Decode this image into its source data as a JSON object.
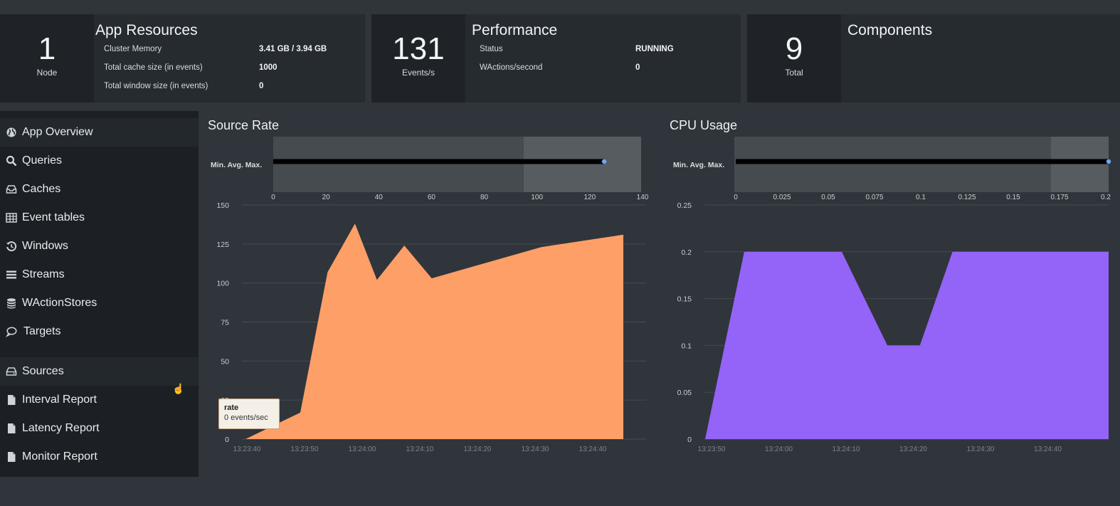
{
  "cards": {
    "resources": {
      "stat_value": "1",
      "stat_unit": "Node",
      "title": "App Resources",
      "rows": [
        {
          "label": "Cluster Memory",
          "value": "3.41 GB / 3.94 GB"
        },
        {
          "label": "Total cache size (in events)",
          "value": "1000"
        },
        {
          "label": "Total window size (in events)",
          "value": "0"
        }
      ]
    },
    "performance": {
      "stat_value": "131",
      "stat_unit": "Events/s",
      "title": "Performance",
      "rows": [
        {
          "label": "Status",
          "value": "RUNNING"
        },
        {
          "label": "WActions/second",
          "value": "0"
        }
      ]
    },
    "components": {
      "stat_value": "9",
      "stat_unit": "Total",
      "title": "Components"
    }
  },
  "sidebar": {
    "items": [
      {
        "label": "App Overview",
        "icon": "globe-icon",
        "active": true
      },
      {
        "label": "Queries",
        "icon": "search-icon"
      },
      {
        "label": "Caches",
        "icon": "inbox-icon"
      },
      {
        "label": "Event tables",
        "icon": "table-icon"
      },
      {
        "label": "Windows",
        "icon": "history-icon"
      },
      {
        "label": "Streams",
        "icon": "bars-icon"
      },
      {
        "label": "WActionStores",
        "icon": "database-icon"
      },
      {
        "label": "Targets",
        "icon": "comment-icon"
      }
    ],
    "items2": [
      {
        "label": "Sources",
        "icon": "hdd-icon",
        "active": true
      },
      {
        "label": "Interval Report",
        "icon": "file-icon"
      },
      {
        "label": "Latency Report",
        "icon": "file-icon"
      },
      {
        "label": "Monitor Report",
        "icon": "file-icon"
      }
    ]
  },
  "colors": {
    "source_area": "#ff9f68",
    "cpu_area": "#9463f7",
    "marker": "#6ea8f0"
  },
  "tooltip": {
    "title": "rate",
    "text": "0 events/sec"
  },
  "chart_data": [
    {
      "type": "area",
      "title": "Source Rate",
      "range_bar": {
        "label": "Min. Avg. Max.",
        "ticks": [
          "0",
          "20",
          "40",
          "60",
          "80",
          "100",
          "120",
          "140"
        ],
        "min": 0,
        "max": 140,
        "value": 131
      },
      "x": [
        "13:23:39",
        "13:23:49",
        "13:23:54",
        "13:23:59",
        "13:24:03",
        "13:24:08",
        "13:24:13",
        "13:24:18",
        "13:24:33",
        "13:24:48"
      ],
      "y": [
        0,
        17,
        107,
        138,
        102,
        124,
        103,
        108,
        123,
        131
      ],
      "xticks": [
        "13:23:40",
        "13:23:50",
        "13:24:00",
        "13:24:10",
        "13:24:20",
        "13:24:30",
        "13:24:40"
      ],
      "yticks": [
        "0",
        "25",
        "50",
        "75",
        "100",
        "125",
        "150"
      ],
      "ylim": [
        0,
        150
      ]
    },
    {
      "type": "area",
      "title": "CPU Usage",
      "range_bar": {
        "label": "Min. Avg. Max.",
        "ticks": [
          "0",
          "0.025",
          "0.05",
          "0.075",
          "0.1",
          "0.125",
          "0.15",
          "0.175",
          "0.2"
        ],
        "min": 0,
        "max": 0.2,
        "value": 0.2
      },
      "x": [
        "13:23:50",
        "13:23:56",
        "13:24:11",
        "13:24:18",
        "13:24:23",
        "13:24:28",
        "13:24:52"
      ],
      "y": [
        0,
        0.2,
        0.2,
        0.1,
        0.1,
        0.2,
        0.2
      ],
      "xticks": [
        "13:23:50",
        "13:24:00",
        "13:24:10",
        "13:24:20",
        "13:24:30",
        "13:24:40"
      ],
      "yticks": [
        "0",
        "0.05",
        "0.1",
        "0.15",
        "0.2",
        "0.25"
      ],
      "ylim": [
        0,
        0.25
      ]
    }
  ]
}
